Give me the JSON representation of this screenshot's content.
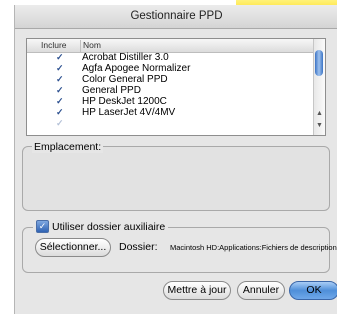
{
  "window": {
    "title": "Gestionnaire PPD"
  },
  "list": {
    "columns": {
      "include": "Inclure",
      "name": "Nom"
    },
    "rows": [
      {
        "checked": true,
        "name": "Acrobat Distiller 3.0"
      },
      {
        "checked": true,
        "name": "Agfa Apogee Normalizer"
      },
      {
        "checked": true,
        "name": "Color General PPD"
      },
      {
        "checked": true,
        "name": "General PPD"
      },
      {
        "checked": true,
        "name": "HP DeskJet 1200C"
      },
      {
        "checked": true,
        "name": "HP LaserJet 4V/4MV"
      }
    ],
    "check_glyph": "✓"
  },
  "emplacement": {
    "label": "Emplacement:"
  },
  "auxiliary": {
    "checkbox_label": "Utiliser dossier auxiliaire",
    "checked": true,
    "select_button": "Sélectionner...",
    "dossier_label": "Dossier:",
    "dossier_path": "Macintosh HD:Applications:Fichiers de description:"
  },
  "buttons": {
    "update": "Mettre à jour",
    "cancel": "Annuler",
    "ok": "OK"
  },
  "colors": {
    "accent": "#4f8fd9",
    "titlebar": "#d4d4d4",
    "corner": "#ffe23a"
  }
}
